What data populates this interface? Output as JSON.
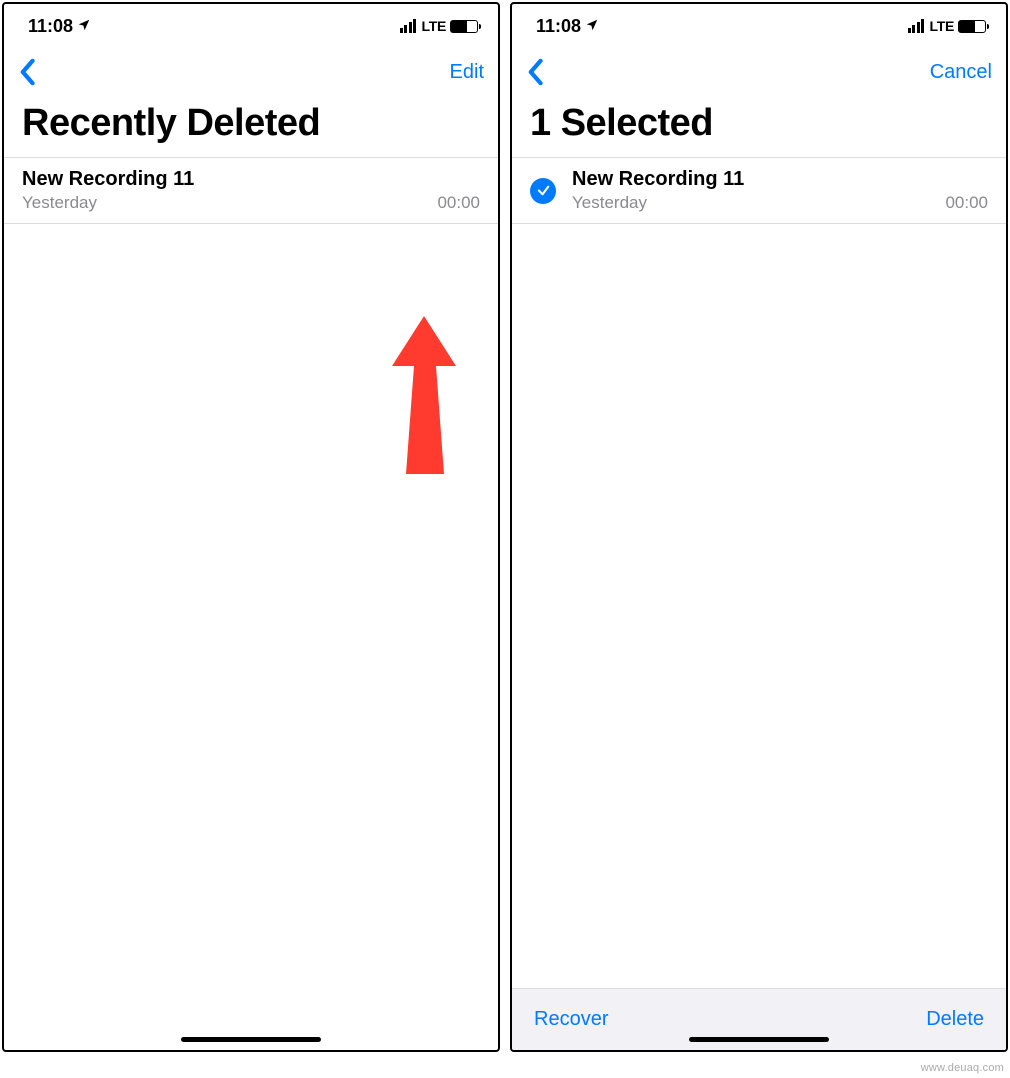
{
  "watermark": "www.deuaq.com",
  "left": {
    "status": {
      "time": "11:08",
      "network": "LTE"
    },
    "nav": {
      "action": "Edit"
    },
    "title": "Recently Deleted",
    "items": [
      {
        "title": "New Recording 11",
        "date": "Yesterday",
        "duration": "00:00"
      }
    ]
  },
  "right": {
    "status": {
      "time": "11:08",
      "network": "LTE"
    },
    "nav": {
      "action": "Cancel"
    },
    "title": "1 Selected",
    "items": [
      {
        "title": "New Recording 11",
        "date": "Yesterday",
        "duration": "00:00",
        "selected": true
      }
    ],
    "toolbar": {
      "recover": "Recover",
      "delete": "Delete"
    }
  }
}
